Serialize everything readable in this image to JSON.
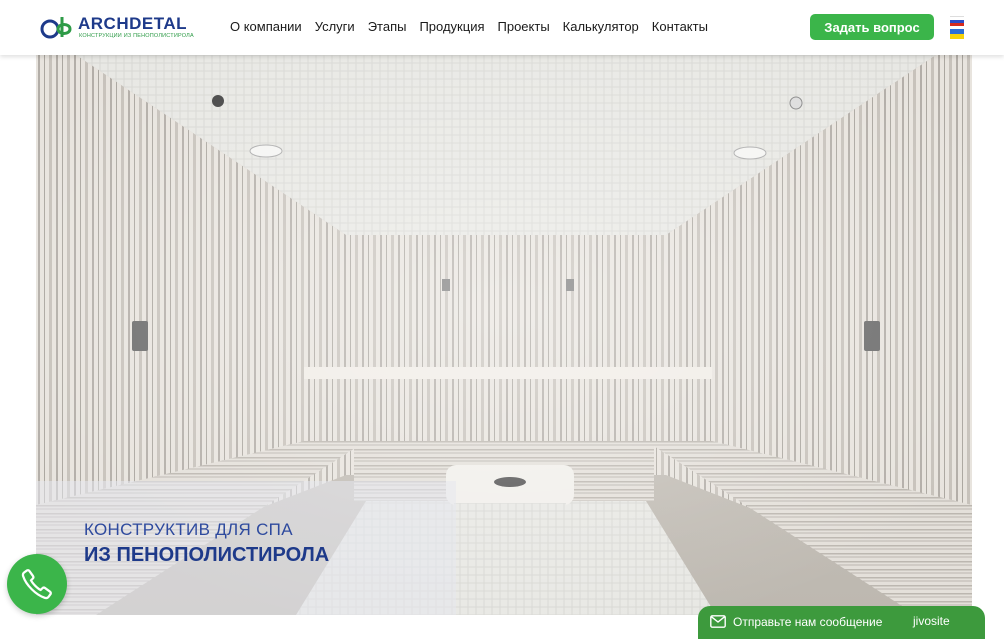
{
  "header": {
    "logo": {
      "name": "ARCHDETAL",
      "tagline": "КОНСТРУКЦИИ ИЗ ПЕНОПОЛИСТИРОЛА"
    },
    "nav": [
      {
        "label": "О компании"
      },
      {
        "label": "Услуги"
      },
      {
        "label": "Этапы"
      },
      {
        "label": "Продукция"
      },
      {
        "label": "Проекты"
      },
      {
        "label": "Калькулятор"
      },
      {
        "label": "Контакты"
      }
    ],
    "cta_label": "Задать вопрос",
    "languages": [
      "ru",
      "ua"
    ]
  },
  "hero": {
    "line1": "КОНСТРУКТИВ ДЛЯ СПА",
    "line2": "ИЗ ПЕНОПОЛИСТИРОЛА"
  },
  "chat": {
    "label": "Отправьте нам сообщение",
    "brand": "jivosite"
  },
  "colors": {
    "accent_green": "#3bb54a",
    "brand_blue": "#1e3a8a",
    "chat_green": "#3d9a3d"
  },
  "icons": {
    "call": "phone-icon",
    "chat": "envelope-icon"
  }
}
